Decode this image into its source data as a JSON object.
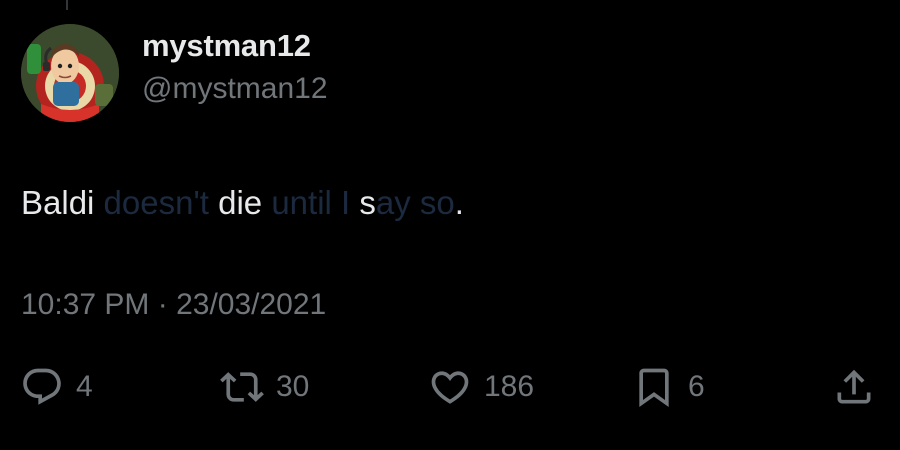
{
  "tweet": {
    "display_name": "mystman12",
    "handle": "@mystman12",
    "text_segments": [
      {
        "text": "Baldi",
        "hidden": false
      },
      {
        "text": " doesn't ",
        "hidden": true
      },
      {
        "text": "die",
        "hidden": false
      },
      {
        "text": " until I ",
        "hidden": true
      },
      {
        "text": "s",
        "hidden": false
      },
      {
        "text": "ay so",
        "hidden": true
      },
      {
        "text": ".",
        "hidden": false
      }
    ],
    "timestamp": "10:37 PM · 23/03/2021"
  },
  "actions": {
    "reply_count": "4",
    "retweet_count": "30",
    "like_count": "186",
    "bookmark_count": "6"
  },
  "colors": {
    "background": "#000000",
    "primary_text": "#e7e9ea",
    "secondary_text": "#71767b"
  },
  "icons": [
    "reply-icon",
    "retweet-icon",
    "like-icon",
    "bookmark-icon",
    "share-icon"
  ]
}
